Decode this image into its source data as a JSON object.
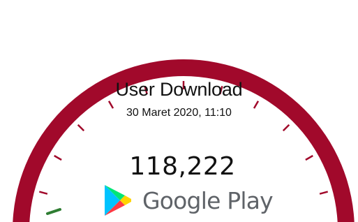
{
  "widget": {
    "title": "User Download",
    "subtitle": "30 Maret 2020, 11:10",
    "value": "118,222",
    "value_number": 118222,
    "brand_name": "Google Play",
    "brand_icon": "google-play-icon"
  },
  "colors": {
    "gauge_track": "#a1092b",
    "gauge_tick": "#a1092b",
    "gauge_needle": "#2e7d32",
    "text": "#111111",
    "brand_text": "#5f6368"
  }
}
